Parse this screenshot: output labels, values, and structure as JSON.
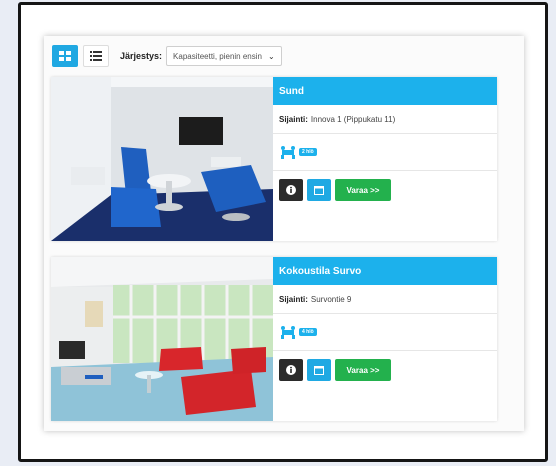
{
  "toolbar": {
    "sort_label": "Järjestys:",
    "sort_value": "Kapasiteetti, pienin ensin",
    "grid_icon": "grid-view-icon",
    "list_icon": "list-view-icon"
  },
  "rooms": [
    {
      "title": "Sund",
      "location_label": "Sijainti:",
      "location_value": "Innova 1 (Pippukatu 11)",
      "capacity_label": "2 hlö",
      "book_label": "Varaa >>"
    },
    {
      "title": "Kokoustila Survo",
      "location_label": "Sijainti:",
      "location_value": "Survontie 9",
      "capacity_label": "4 hlö",
      "book_label": "Varaa >>"
    }
  ],
  "colors": {
    "accent": "#1cb1ec",
    "book_button": "#23b14d",
    "info_button": "#2b2b2b"
  }
}
